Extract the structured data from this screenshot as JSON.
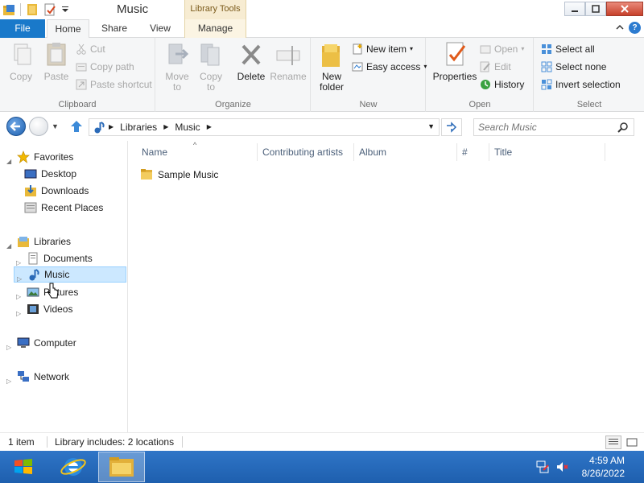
{
  "window": {
    "title": "Music",
    "context_tab_group": "Library Tools"
  },
  "tabs": {
    "file": "File",
    "home": "Home",
    "share": "Share",
    "view": "View",
    "manage": "Manage"
  },
  "ribbon": {
    "clipboard": {
      "label": "Clipboard",
      "copy": "Copy",
      "paste": "Paste",
      "cut": "Cut",
      "copy_path": "Copy path",
      "paste_shortcut": "Paste shortcut"
    },
    "organize": {
      "label": "Organize",
      "move_to": "Move to",
      "copy_to": "Copy to",
      "delete": "Delete",
      "rename": "Rename"
    },
    "new": {
      "label": "New",
      "new_folder": "New folder",
      "new_item": "New item",
      "easy_access": "Easy access"
    },
    "open": {
      "label": "Open",
      "properties": "Properties",
      "open": "Open",
      "edit": "Edit",
      "history": "History"
    },
    "select": {
      "label": "Select",
      "select_all": "Select all",
      "select_none": "Select none",
      "invert_selection": "Invert selection"
    }
  },
  "address": {
    "crumbs": [
      "Libraries",
      "Music"
    ],
    "search_placeholder": "Search Music"
  },
  "navpane": {
    "favorites": "Favorites",
    "desktop": "Desktop",
    "downloads": "Downloads",
    "recent_places": "Recent Places",
    "libraries": "Libraries",
    "documents": "Documents",
    "music": "Music",
    "pictures": "Pictures",
    "videos": "Videos",
    "computer": "Computer",
    "network": "Network"
  },
  "columns": [
    "Name",
    "Contributing artists",
    "Album",
    "#",
    "Title"
  ],
  "files": [
    {
      "name": "Sample Music"
    }
  ],
  "status": {
    "count": "1 item",
    "library_info": "Library includes: 2 locations"
  },
  "clock": {
    "time": "4:59 AM",
    "date": "8/26/2022"
  },
  "colors": {
    "accent": "#1979ca",
    "taskbar": "#1e5fae",
    "selection": "#cce8ff",
    "context_tab": "#f7ecd2"
  }
}
